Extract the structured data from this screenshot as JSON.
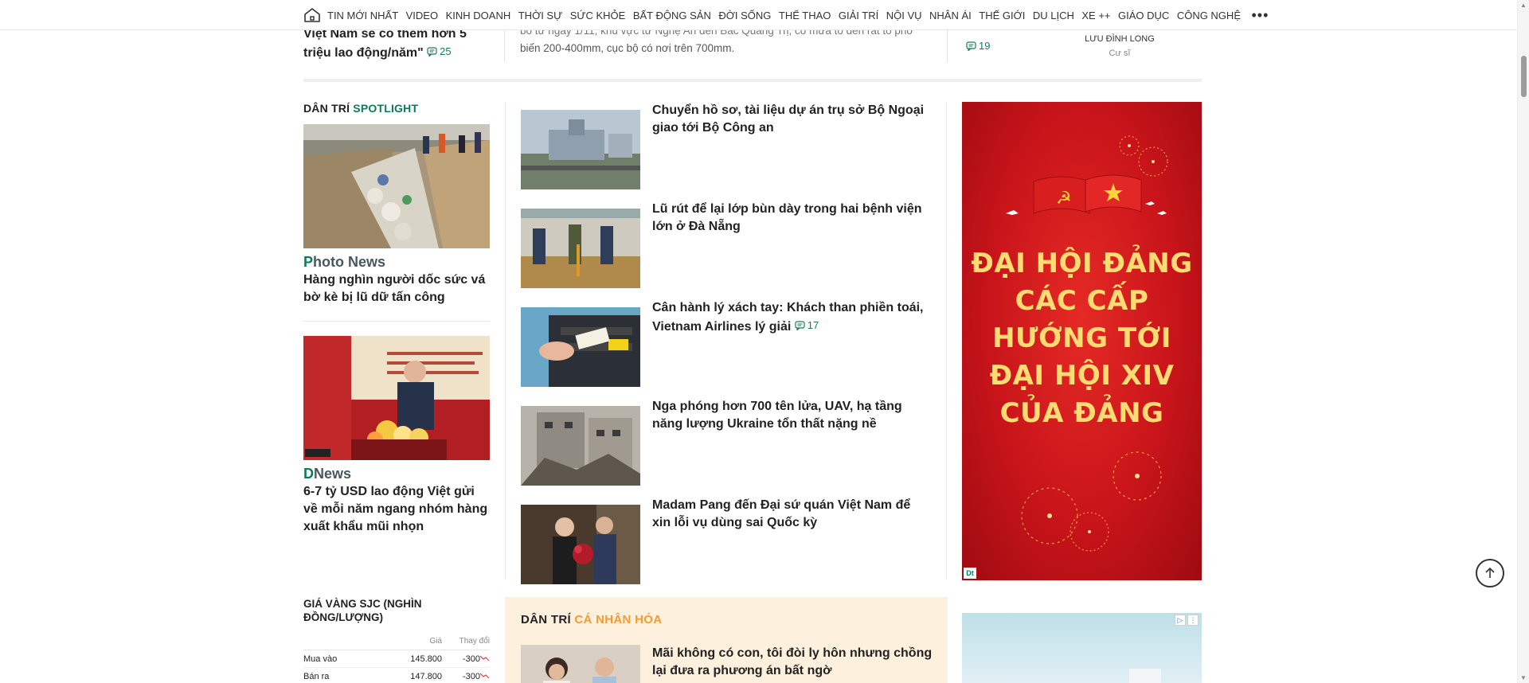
{
  "nav": {
    "items": [
      "TIN MỚI NHẤT",
      "VIDEO",
      "KINH DOANH",
      "THỜI SỰ",
      "SỨC KHỎE",
      "BẤT ĐỘNG SẢN",
      "ĐỜI SỐNG",
      "THỂ THAO",
      "GIẢI TRÍ",
      "NỘI VỤ",
      "NHÂN ÁI",
      "THẾ GIỚI",
      "DU LỊCH",
      "XE ++",
      "GIÁO DỤC",
      "CÔNG NGHỆ"
    ],
    "more": "•••"
  },
  "top_row": {
    "left_title": "Việt Nam sẽ có thêm hơn 5 triệu lao động/năm\"",
    "left_comments": "25",
    "mid_text_line1": "bố từ ngày 1/11, khu vực từ Nghệ An đến Bắc Quảng Trị, có mưa to đến rất to phổ",
    "mid_text_line2": "biến 200-400mm, cục bộ có nơi trên 700mm.",
    "right_comments": "19",
    "author_name": "LƯU ĐÌNH LONG",
    "author_role": "Cư sĩ"
  },
  "spotlight": {
    "label": "DÂN TRÍ",
    "accent": "SPOTLIGHT",
    "items": [
      {
        "brand_prefix": "P",
        "brand_rest": "hoto News",
        "title": "Hàng nghìn người dốc sức vá bờ kè bị lũ dữ tấn công"
      },
      {
        "brand_prefix": "D",
        "brand_rest": "News",
        "title": "6-7 tỷ USD lao động Việt gửi về mỗi năm ngang nhóm hàng xuất khẩu mũi nhọn"
      }
    ]
  },
  "middle": {
    "items": [
      {
        "title": "Chuyển hồ sơ, tài liệu dự án trụ sở Bộ Ngoại giao tới Bộ Công an",
        "comments": ""
      },
      {
        "title": "Lũ rút để lại lớp bùn dày trong hai bệnh viện lớn ở Đà Nẵng",
        "comments": ""
      },
      {
        "title": "Cân hành lý xách tay: Khách than phiền toái, Vietnam Airlines lý giải",
        "comments": "17"
      },
      {
        "title": "Nga phóng hơn 700 tên lửa, UAV, hạ tầng năng lượng Ukraine tổn thất nặng nề",
        "comments": ""
      },
      {
        "title": "Madam Pang đến Đại sứ quán Việt Nam để xin lỗi vụ dùng sai Quốc kỳ",
        "comments": ""
      }
    ]
  },
  "personal": {
    "label": "DÂN TRÍ",
    "accent": "CÁ NHÂN HÓA",
    "item_title": "Mãi không có con, tôi đòi ly hôn nhưng chồng lại đưa ra phương án bất ngờ"
  },
  "gold": {
    "title": "GIÁ VÀNG SJC (NGHÌN ĐỒNG/LƯỢNG)",
    "col_price": "Giá",
    "col_change": "Thay đổi",
    "rows": [
      {
        "label": "Mua vào",
        "price": "145.800",
        "change": "-300"
      },
      {
        "label": "Bán ra",
        "price": "147.800",
        "change": "-300"
      }
    ]
  },
  "ad": {
    "text_lines": [
      "ĐẠI HỘI ĐẢNG",
      "CÁC CẤP",
      "HƯỚNG TỚI",
      "ĐẠI HỘI XIV",
      "CỦA ĐẢNG"
    ],
    "logo": "Dt"
  },
  "colors": {
    "brand_green": "#0e7a57",
    "accent_orange": "#f39c32",
    "ad_red": "#c8141a",
    "ad_gold": "#ffdb74"
  }
}
